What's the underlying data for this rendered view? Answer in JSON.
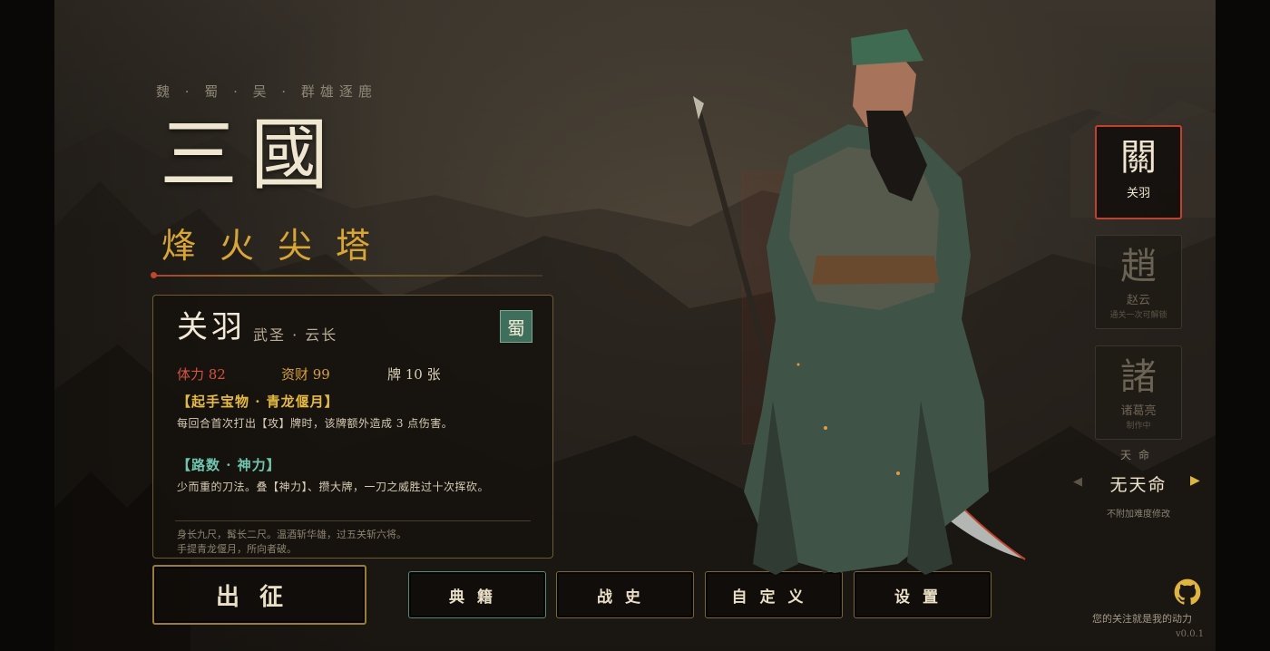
{
  "title": {
    "kingdoms": "魏 · 蜀 · 吴 · 群雄逐鹿",
    "main": "三國",
    "subtitle": "烽火尖塔"
  },
  "hero_card": {
    "name": "关羽",
    "titles": "武圣 · 云长",
    "faction": "蜀",
    "stats": {
      "hp": "体力 82",
      "gold": "资财 99",
      "cards": "牌 10 张"
    },
    "treasure_title": "【起手宝物 · 青龙偃月】",
    "treasure_desc": "每回合首次打出【攻】牌时，该牌额外造成 3 点伤害。",
    "path_title": "【路数 · 神力】",
    "path_desc": "少而重的刀法。叠【神力】、攒大牌，一刀之威胜过十次挥砍。",
    "bio_line1": "身长九尺，髯长二尺。温酒斩华雄，过五关斩六将。",
    "bio_line2": "手提青龙偃月，所向者破。"
  },
  "buttons": {
    "start": "出征",
    "codex": "典籍",
    "history": "战史",
    "custom": "自定义",
    "settings": "设置"
  },
  "characters": [
    {
      "glyph": "關",
      "name": "关羽",
      "note": ""
    },
    {
      "glyph": "趙",
      "name": "赵云",
      "note": "通关一次可解锁"
    },
    {
      "glyph": "諸",
      "name": "诸葛亮",
      "note": "制作中"
    }
  ],
  "tianming": {
    "label": "天命",
    "value": "无天命",
    "note": "不附加难度修改"
  },
  "footer": {
    "slogan": "您的关注就是我的动力",
    "version": "v0.0.1"
  },
  "colors": {
    "accent_gold": "#d9a72f",
    "accent_red": "#c4402d",
    "hp_red": "#d8533e",
    "path_teal": "#6fc6b0",
    "faction_green": "#3e6e5c"
  }
}
